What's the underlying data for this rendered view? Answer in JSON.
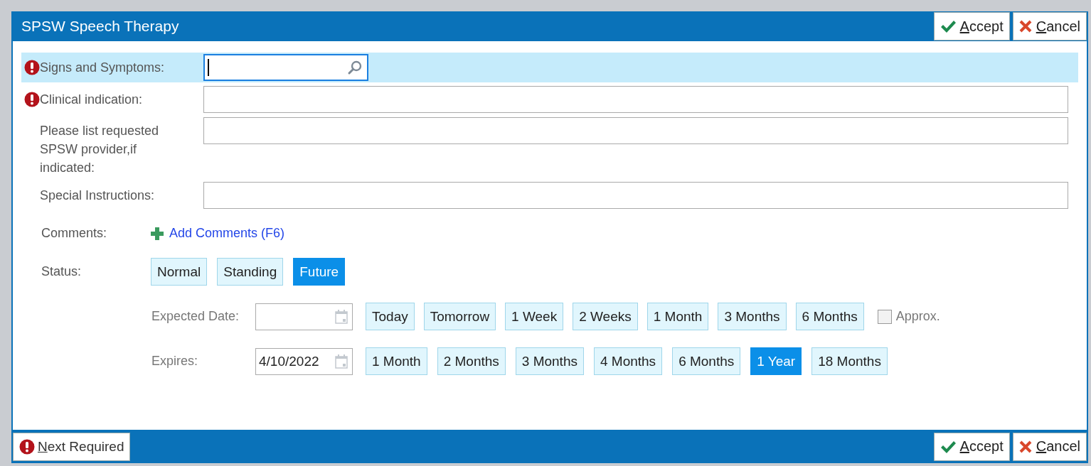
{
  "window": {
    "title": "SPSW Speech Therapy"
  },
  "header_buttons": [
    {
      "label": "Accept",
      "kind": "accept"
    },
    {
      "label": "Cancel",
      "kind": "cancel"
    }
  ],
  "fields": [
    {
      "label": "Signs and Symptoms:",
      "required": true,
      "kind": "search",
      "focused": true
    },
    {
      "label": "Clinical indication:",
      "required": true,
      "kind": "text",
      "focused": false
    },
    {
      "label": "Please list requested SPSW provider,if indicated:",
      "required": false,
      "kind": "text",
      "focused": false
    },
    {
      "label": "Special Instructions:",
      "required": false,
      "kind": "text",
      "focused": false
    }
  ],
  "comments": {
    "label": "Comments:",
    "link": "Add Comments (F6)"
  },
  "status": {
    "label": "Status:",
    "options": [
      {
        "label": "Normal",
        "selected": false
      },
      {
        "label": "Standing",
        "selected": false
      },
      {
        "label": "Future",
        "selected": true
      }
    ]
  },
  "expected_date": {
    "label": "Expected Date:",
    "options": [
      {
        "label": "Today",
        "selected": false
      },
      {
        "label": "Tomorrow",
        "selected": false
      },
      {
        "label": "1 Week",
        "selected": false
      },
      {
        "label": "2 Weeks",
        "selected": false
      },
      {
        "label": "1 Month",
        "selected": false
      },
      {
        "label": "3 Months",
        "selected": false
      },
      {
        "label": "6 Months",
        "selected": false
      }
    ],
    "approx": {
      "label": "Approx.",
      "checked": false
    }
  },
  "expires": {
    "label": "Expires:",
    "value": "4/10/2022",
    "options": [
      {
        "label": "1 Month",
        "selected": false
      },
      {
        "label": "2 Months",
        "selected": false
      },
      {
        "label": "3 Months",
        "selected": false
      },
      {
        "label": "4 Months",
        "selected": false
      },
      {
        "label": "6 Months",
        "selected": false
      },
      {
        "label": "1 Year",
        "selected": true
      },
      {
        "label": "18 Months",
        "selected": false
      }
    ]
  },
  "footer": {
    "next_required": "Next Required",
    "buttons": [
      {
        "label": "Accept",
        "kind": "accept"
      },
      {
        "label": "Cancel",
        "kind": "cancel"
      }
    ]
  }
}
